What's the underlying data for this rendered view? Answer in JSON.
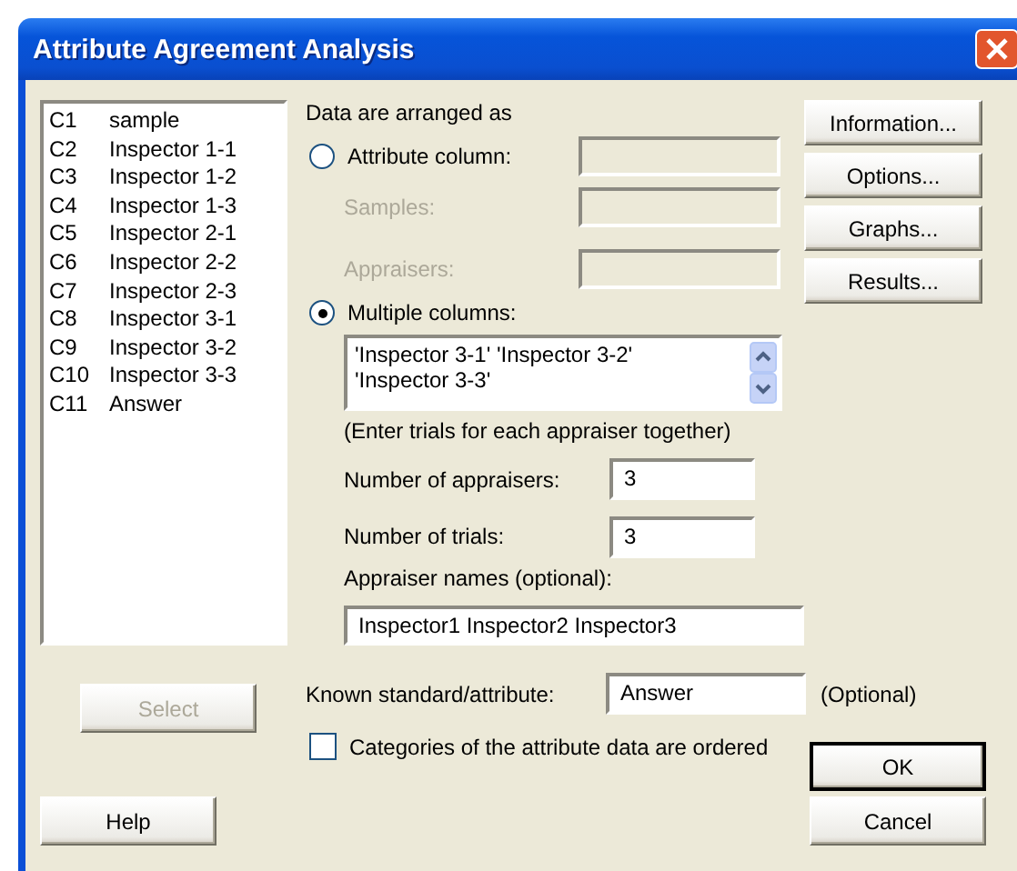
{
  "window": {
    "title": "Attribute Agreement Analysis"
  },
  "columns_list": [
    {
      "number": "C1",
      "name": "sample"
    },
    {
      "number": "C2",
      "name": "Inspector 1-1"
    },
    {
      "number": "C3",
      "name": "Inspector 1-2"
    },
    {
      "number": "C4",
      "name": "Inspector 1-3"
    },
    {
      "number": "C5",
      "name": "Inspector 2-1"
    },
    {
      "number": "C6",
      "name": "Inspector 2-2"
    },
    {
      "number": "C7",
      "name": "Inspector 2-3"
    },
    {
      "number": "C8",
      "name": "Inspector 3-1"
    },
    {
      "number": "C9",
      "name": "Inspector 3-2"
    },
    {
      "number": "C10",
      "name": "Inspector 3-3"
    },
    {
      "number": "C11",
      "name": "Answer"
    }
  ],
  "arrangement": {
    "label": "Data are arranged as",
    "options": [
      {
        "kind": "single",
        "label": "Attribute column:",
        "selected": false,
        "field_disabled": true,
        "subfields": [
          {
            "label": "Samples:",
            "disabled": true
          },
          {
            "label": "Appraisers:",
            "disabled": true
          }
        ]
      },
      {
        "kind": "list",
        "label": "Multiple columns:",
        "selected": true,
        "value": "'Inspector 3-1' 'Inspector 3-2' 'Inspector 3-3'",
        "note": "(Enter trials for each appraiser together)"
      }
    ]
  },
  "number_of_appraisers": {
    "label": "Number of appraisers:",
    "value": "3"
  },
  "number_of_trials": {
    "label": "Number of trials:",
    "value": "3"
  },
  "appraiser_names": {
    "label": "Appraiser names (optional):",
    "value": "Inspector1 Inspector2 Inspector3"
  },
  "known_standard": {
    "label": "Known standard/attribute:",
    "value": "Answer",
    "suffix": "(Optional)"
  },
  "ordered_categories": {
    "label": "Categories of the attribute data are ordered",
    "checked": false
  },
  "side_buttons": [
    "Information...",
    "Options...",
    "Graphs...",
    "Results..."
  ],
  "select_button": {
    "label": "Select",
    "disabled": true
  },
  "help_button": "Help",
  "dialog_buttons": [
    {
      "label": "OK",
      "default": true
    },
    {
      "label": "Cancel",
      "default": false
    }
  ]
}
